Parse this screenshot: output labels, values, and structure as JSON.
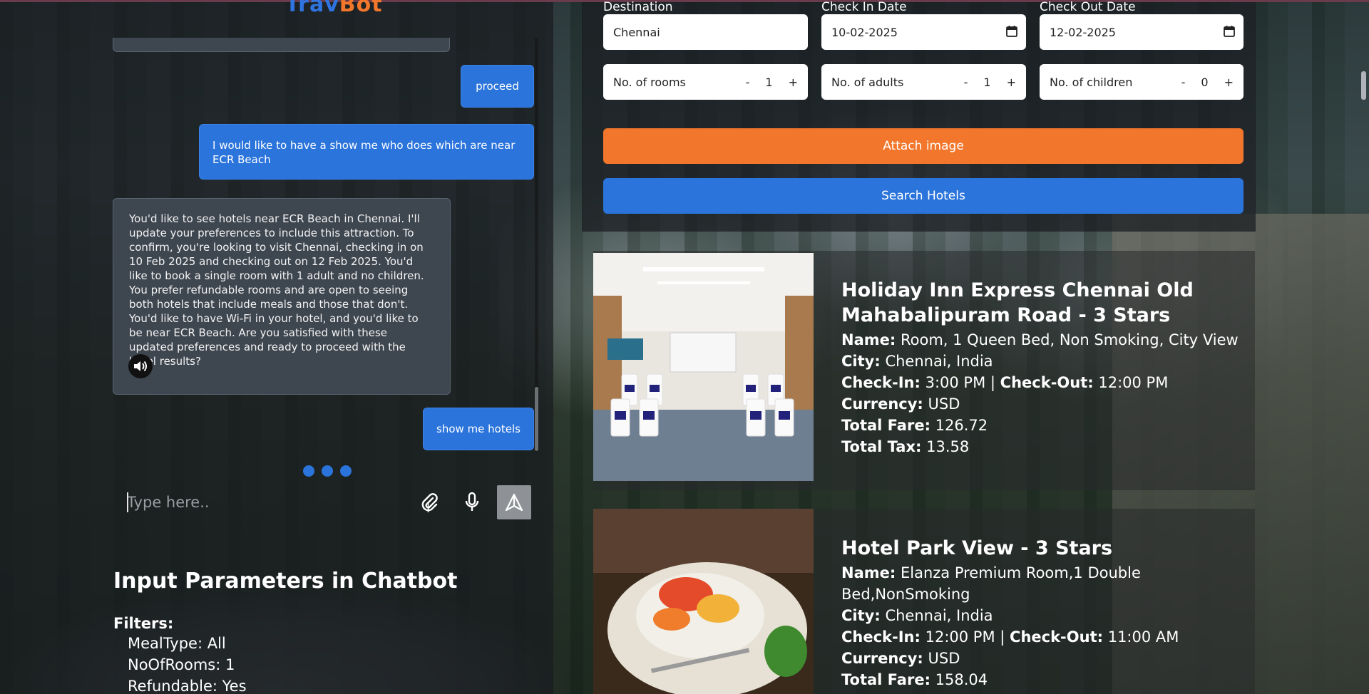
{
  "brand": {
    "part1": "Trav",
    "part2": "Bot"
  },
  "chat": {
    "messages": {
      "user1": "proceed",
      "user2": "I would like to have a show me who does which are near ECR Beach",
      "bot1": "You'd like to see hotels near ECR Beach in Chennai. I'll update your preferences to include this attraction. To confirm, you're looking to visit Chennai, checking in on 10 Feb 2025 and checking out on 12 Feb 2025. You'd like to book a single room with 1 adult and no children. You prefer refundable rooms and are open to seeing both hotels that include meals and those that don't. You'd like to have Wi-Fi in your hotel, and you'd like to be near ECR Beach. Are you satisfied with these updated preferences and ready to proceed with the hotel results?",
      "user3": "show me hotels"
    },
    "input": {
      "placeholder": "Type here..",
      "value": ""
    },
    "icons": {
      "speaker": "speaker-icon",
      "attach": "paperclip-icon",
      "mic": "microphone-icon",
      "send": "send-icon"
    }
  },
  "params": {
    "title": "Input Parameters in Chatbot",
    "filters_label": "Filters:",
    "filters": [
      "MealType: All",
      "NoOfRooms: 1",
      "Refundable: Yes"
    ]
  },
  "search": {
    "destination": {
      "label": "Destination",
      "value": "Chennai"
    },
    "checkin": {
      "label": "Check In Date",
      "value": "10-02-2025"
    },
    "checkout": {
      "label": "Check Out Date",
      "value": "12-02-2025"
    },
    "rooms": {
      "label": "No. of rooms",
      "value": "1",
      "minus": "-",
      "plus": "+"
    },
    "adults": {
      "label": "No. of adults",
      "value": "1",
      "minus": "-",
      "plus": "+"
    },
    "children": {
      "label": "No. of children",
      "value": "0",
      "minus": "-",
      "plus": "+"
    },
    "attach_label": "Attach image",
    "search_label": "Search Hotels"
  },
  "hotels": [
    {
      "title": "Holiday Inn Express Chennai Old Mahabalipuram Road - 3 Stars",
      "name_label": "Name:",
      "name": "Room, 1 Queen Bed, Non Smoking, City View",
      "city_label": "City:",
      "city": "Chennai, India",
      "checkin_label": "Check-In:",
      "checkin": "3:00 PM",
      "sep": "|",
      "checkout_label": "Check-Out:",
      "checkout": "12:00 PM",
      "currency_label": "Currency:",
      "currency": "USD",
      "fare_label": "Total Fare:",
      "fare": "126.72",
      "tax_label": "Total Tax:",
      "tax": "13.58"
    },
    {
      "title": "Hotel Park View - 3 Stars",
      "name_label": "Name:",
      "name": "Elanza Premium Room,1 Double Bed,NonSmoking",
      "city_label": "City:",
      "city": "Chennai, India",
      "checkin_label": "Check-In:",
      "checkin": "12:00 PM",
      "sep": "|",
      "checkout_label": "Check-Out:",
      "checkout": "11:00 AM",
      "currency_label": "Currency:",
      "currency": "USD",
      "fare_label": "Total Fare:",
      "fare": "158.04"
    }
  ],
  "colors": {
    "accent_blue": "#2b74db",
    "accent_orange": "#f2762b"
  }
}
